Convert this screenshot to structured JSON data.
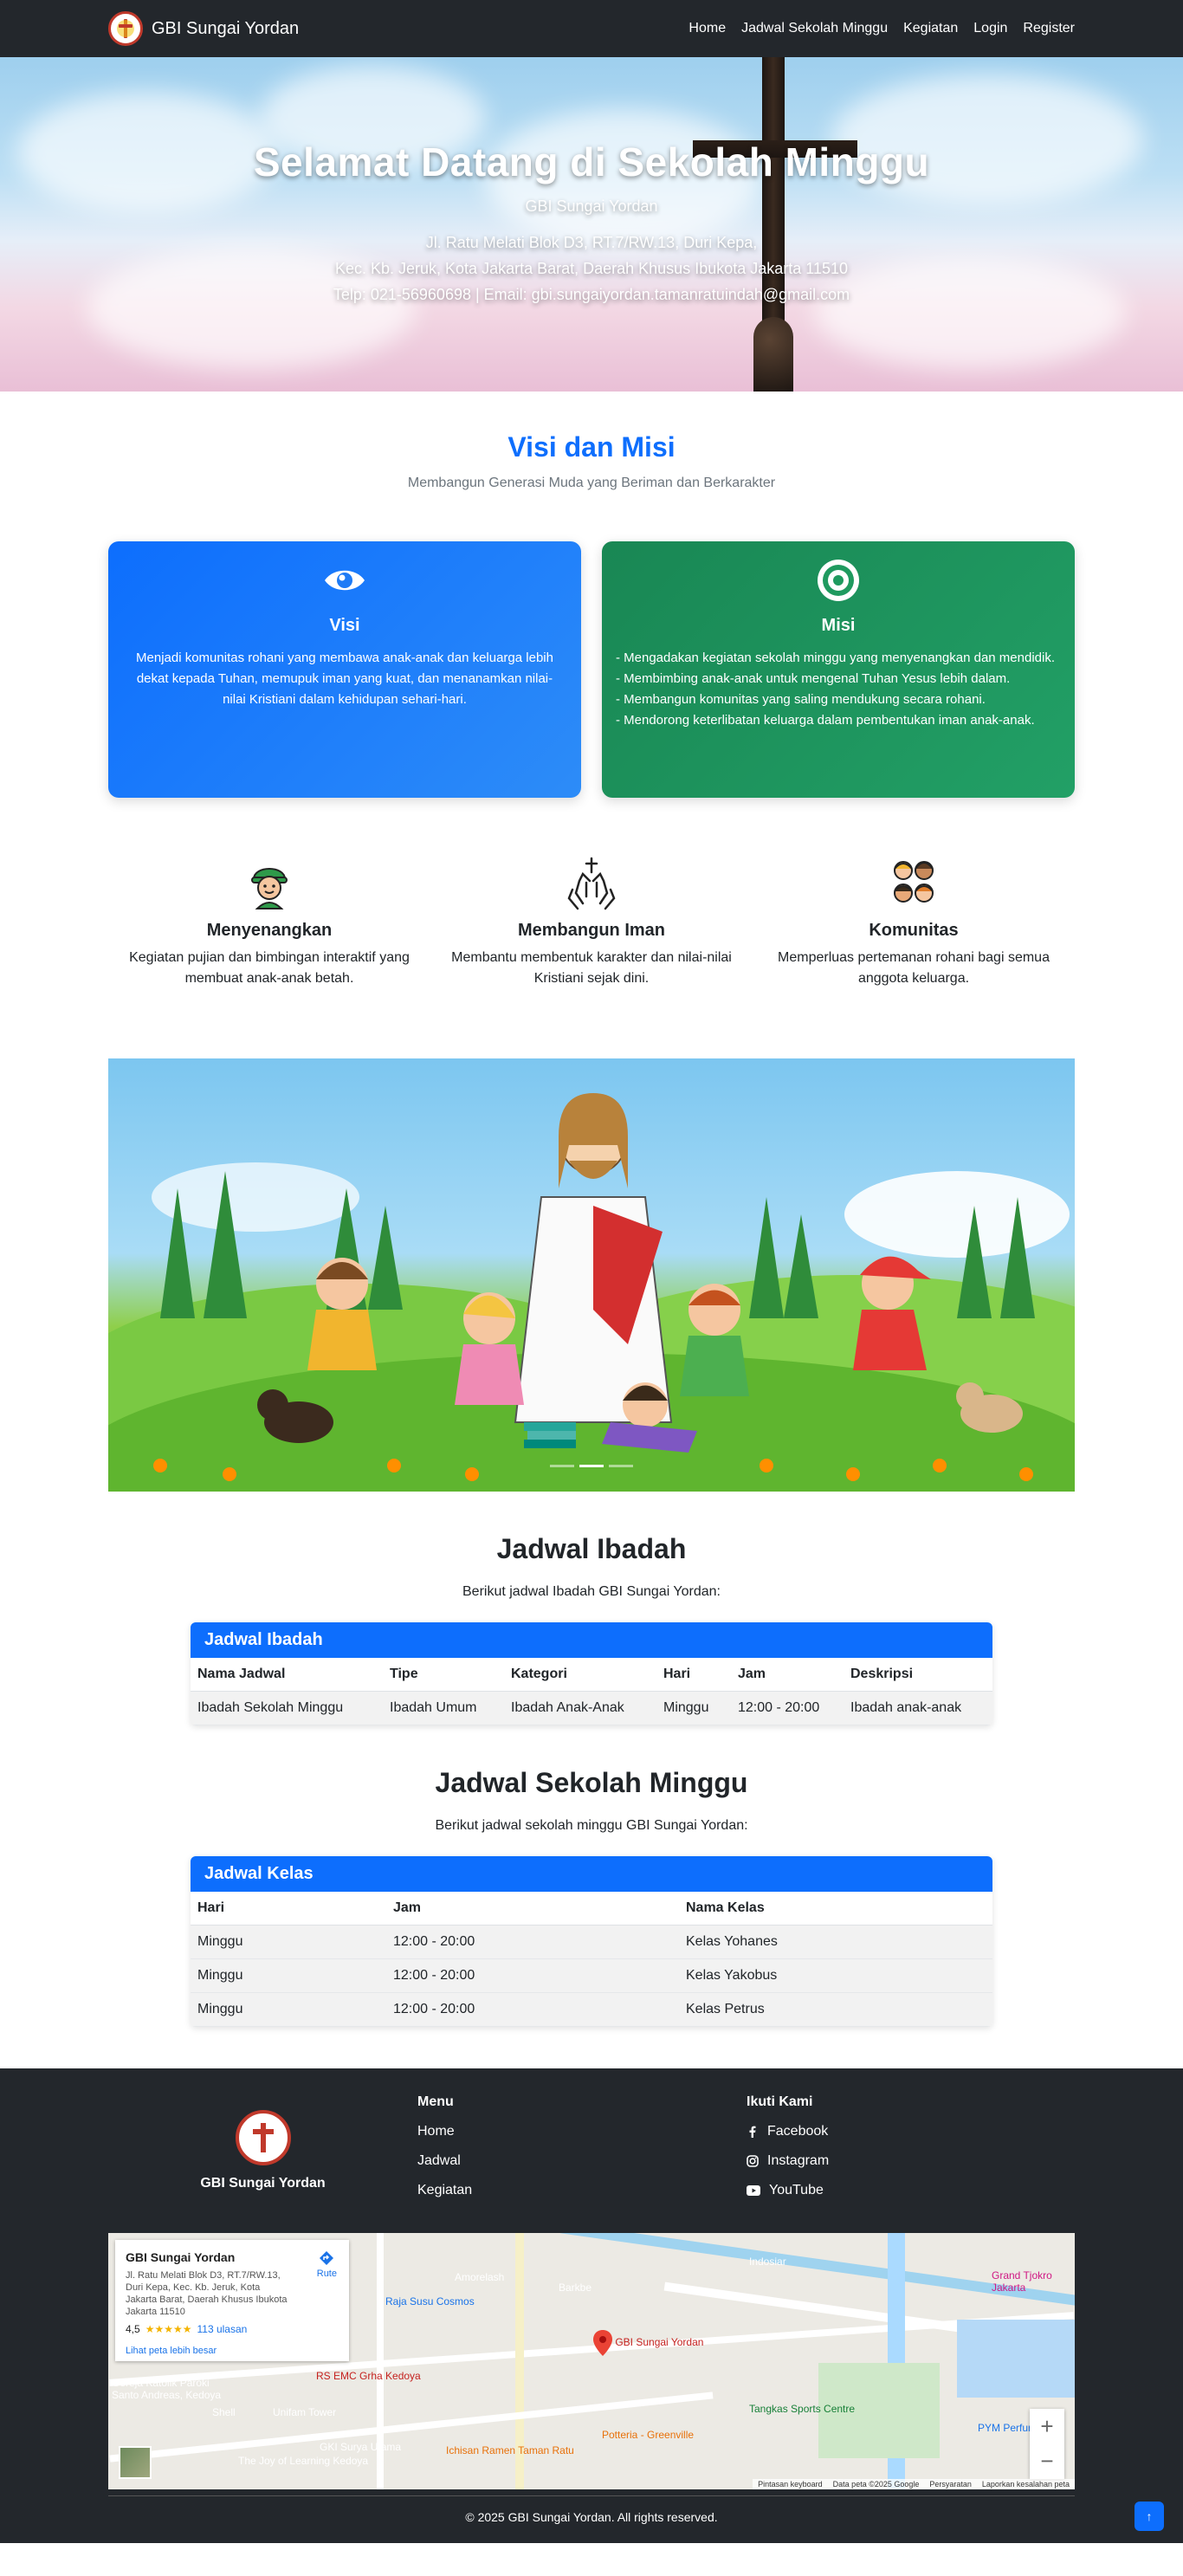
{
  "navbar": {
    "brand": "GBI Sungai Yordan",
    "links": [
      "Home",
      "Jadwal Sekolah Minggu",
      "Kegiatan",
      "Login",
      "Register"
    ]
  },
  "hero": {
    "title": "Selamat Datang di Sekolah Minggu",
    "subtitle": "GBI Sungai Yordan",
    "address_line1": "Jl. Ratu Melati Blok D3, RT.7/RW.13, Duri Kepa,",
    "address_line2": "Kec. Kb. Jeruk, Kota Jakarta Barat, Daerah Khusus Ibukota Jakarta 11510",
    "contact_line": "Telp: 021-56960698 | Email: gbi.sungaiyordan.tamanratuindah@gmail.com"
  },
  "visi_misi": {
    "title": "Visi dan Misi",
    "subtitle": "Membangun Generasi Muda yang Beriman dan Berkarakter",
    "visi": {
      "icon": "eye-icon",
      "title": "Visi",
      "text": "Menjadi komunitas rohani yang membawa anak-anak dan keluarga lebih dekat kepada Tuhan, memupuk iman yang kuat, dan menanamkan nilai-nilai Kristiani dalam kehidupan sehari-hari."
    },
    "misi": {
      "icon": "bullseye-icon",
      "title": "Misi",
      "items": [
        "- Mengadakan kegiatan sekolah minggu yang menyenangkan dan mendidik.",
        "- Membimbing anak-anak untuk mengenal Tuhan Yesus lebih dalam.",
        "- Membangun komunitas yang saling mendukung secara rohani.",
        "- Mendorong keterlibatan keluarga dalam pembentukan iman anak-anak."
      ]
    }
  },
  "features": [
    {
      "icon": "child-icon",
      "title": "Menyenangkan",
      "text": "Kegiatan pujian dan bimbingan interaktif yang membuat anak-anak betah."
    },
    {
      "icon": "praying-hands-icon",
      "title": "Membangun Iman",
      "text": "Membantu membentuk karakter dan nilai-nilai Kristiani sejak dini."
    },
    {
      "icon": "community-icon",
      "title": "Komunitas",
      "text": "Memperluas pertemanan rohani bagi semua anggota keluarga."
    }
  ],
  "carousel": {
    "slide_count": 3,
    "active_index": 1
  },
  "jadwal_ibadah": {
    "title": "Jadwal Ibadah",
    "subtitle": "Berikut jadwal Ibadah GBI Sungai Yordan:",
    "table_title": "Jadwal Ibadah",
    "headers": [
      "Nama Jadwal",
      "Tipe",
      "Kategori",
      "Hari",
      "Jam",
      "Deskripsi"
    ],
    "rows": [
      [
        "Ibadah Sekolah Minggu",
        "Ibadah Umum",
        "Ibadah Anak-Anak",
        "Minggu",
        "12:00 - 20:00",
        "Ibadah anak-anak"
      ]
    ]
  },
  "jadwal_sekolah": {
    "title": "Jadwal Sekolah Minggu",
    "subtitle": "Berikut jadwal sekolah minggu GBI Sungai Yordan:",
    "table_title": "Jadwal Kelas",
    "headers": [
      "Hari",
      "Jam",
      "Nama Kelas"
    ],
    "rows": [
      [
        "Minggu",
        "12:00 - 20:00",
        "Kelas Yohanes"
      ],
      [
        "Minggu",
        "12:00 - 20:00",
        "Kelas Yakobus"
      ],
      [
        "Minggu",
        "12:00 - 20:00",
        "Kelas Petrus"
      ]
    ]
  },
  "footer": {
    "brand": "GBI Sungai Yordan",
    "menu_title": "Menu",
    "menu": [
      "Home",
      "Jadwal",
      "Kegiatan"
    ],
    "social_title": "Ikuti Kami",
    "social": [
      {
        "icon": "facebook-icon",
        "label": "Facebook"
      },
      {
        "icon": "instagram-icon",
        "label": "Instagram"
      },
      {
        "icon": "youtube-icon",
        "label": "YouTube"
      }
    ],
    "copyright": "© 2025 GBI Sungai Yordan. All rights reserved.",
    "back_to_top": "↑"
  },
  "map": {
    "place_title": "GBI Sungai Yordan",
    "place_address": "Jl. Ratu Melati Blok D3, RT.7/RW.13, Duri Kepa, Kec. Kb. Jeruk, Kota Jakarta Barat, Daerah Khusus Ibukota Jakarta 11510",
    "rating": "4,5",
    "stars": "★★★★★",
    "reviews": "113 ulasan",
    "larger_map": "Lihat peta lebih besar",
    "route": "Rute",
    "pin_label": "GBI Sungai Yordan",
    "labels": [
      "Amorelash",
      "Raja Susu Cosmos",
      "Barkbe",
      "Indosiar",
      "RS EMC Grha Kedoya",
      "Shell",
      "Unifam Tower",
      "GKI Surya Utama",
      "Ichisan Ramen Taman Ratu",
      "Potteria - Greenville",
      "Tangkas Sports Centre",
      "Gereja Katolik Paroki Santo Andreas, Kedoya",
      "The Joy of Learning Kedoya",
      "PYM Perfume",
      "Grand Tjokro Jakarta"
    ],
    "zoom_in": "+",
    "zoom_out": "−",
    "footer_items": [
      "Pintasan keyboard",
      "Data peta ©2025 Google",
      "Persyaratan",
      "Laporkan kesalahan peta"
    ]
  }
}
